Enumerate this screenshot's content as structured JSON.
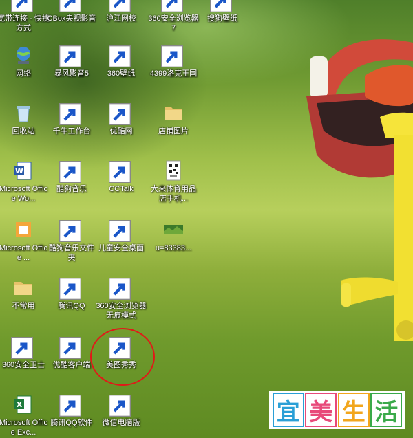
{
  "icons": [
    {
      "label": "宽带连接 - 快捷方式",
      "icon": "broadband-connection-icon"
    },
    {
      "label": "CBox央视影音",
      "icon": "cbox-icon"
    },
    {
      "label": "沪江网校",
      "icon": "hujiang-icon"
    },
    {
      "label": "360安全浏览器7",
      "icon": "360-browser-icon"
    },
    {
      "label": "搜狗壁纸",
      "icon": "sogou-wallpaper-icon"
    },
    {
      "label": "网络",
      "icon": "network-icon"
    },
    {
      "label": "暴风影音5",
      "icon": "baofeng-icon"
    },
    {
      "label": "360壁纸",
      "icon": "360-wallpaper-icon"
    },
    {
      "label": "4399洛克王国",
      "icon": "4399-roco-icon"
    },
    {
      "label": "回收站",
      "icon": "recycle-bin-icon"
    },
    {
      "label": "千牛工作台",
      "icon": "qianniu-icon"
    },
    {
      "label": "优酷网",
      "icon": "youku-icon"
    },
    {
      "label": "店铺图片",
      "icon": "folder-icon"
    },
    {
      "label": "Microsoft Office Wo...",
      "icon": "word-icon"
    },
    {
      "label": "酷狗音乐",
      "icon": "kugou-icon"
    },
    {
      "label": "CCTalk",
      "icon": "cctalk-icon"
    },
    {
      "label": "大来体育用品店手机...",
      "icon": "qr-code-image-icon"
    },
    {
      "label": "Microsoft Office ...",
      "icon": "office-icon"
    },
    {
      "label": "酷狗音乐文件夹",
      "icon": "kugou-folder-icon"
    },
    {
      "label": "儿童安全桌面",
      "icon": "kids-desktop-icon"
    },
    {
      "label": "u=83383...",
      "icon": "image-thumbnail-icon"
    },
    {
      "label": "不常用",
      "icon": "folder-icon"
    },
    {
      "label": "腾讯QQ",
      "icon": "qq-icon"
    },
    {
      "label": "360安全浏览器无痕模式",
      "icon": "360-private-browser-icon"
    },
    {
      "label": "360安全卫士",
      "icon": "360-security-icon"
    },
    {
      "label": "优酷客户端",
      "icon": "youku-client-icon"
    },
    {
      "label": "美图秀秀",
      "icon": "meitu-icon"
    },
    {
      "label": "Microsoft Office Exc...",
      "icon": "excel-icon"
    },
    {
      "label": "腾讯QQ软件",
      "icon": "qq-software-icon"
    },
    {
      "label": "微信电脑版",
      "icon": "wechat-icon"
    }
  ],
  "watermark": {
    "chars": [
      "宜",
      "美",
      "生",
      "活"
    ],
    "colors": [
      "#2a9fd6",
      "#e84a7a",
      "#f2a61c",
      "#3aaa4a"
    ]
  },
  "colors": {
    "highlight": "#e21818"
  }
}
